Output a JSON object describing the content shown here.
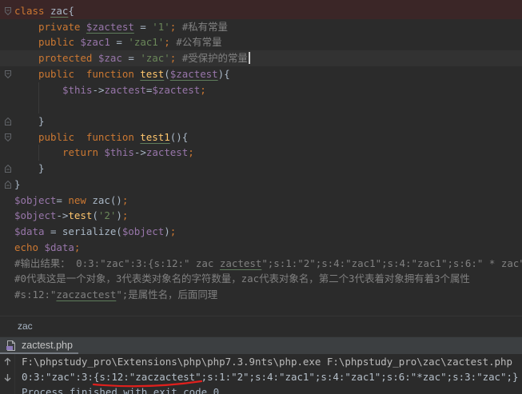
{
  "theme": {
    "background": "#2b2b2b",
    "keyword": "#cc7832",
    "variable": "#9876aa",
    "string": "#6a8759",
    "comment": "#808080",
    "function": "#ffc66d",
    "text": "#a9b7c6",
    "marked_line": "#3b2627",
    "current_line": "#323232",
    "typo_underline": "#5f7d5c",
    "annotation": "#e0201d"
  },
  "editor": {
    "lines": [
      {
        "indent": 0,
        "marked": true,
        "fold_open": true,
        "tokens": [
          {
            "kw": "class "
          },
          {
            "txt": "zac",
            "typo": true
          },
          {
            "txt": "{"
          }
        ]
      },
      {
        "indent": 1,
        "tokens": [
          {
            "kw": "private "
          },
          {
            "var": "$zactest",
            "typo": true
          },
          {
            "txt": " = "
          },
          {
            "str": "'1'"
          },
          {
            "kw": ";"
          },
          {
            "cmt": " #私有常量"
          }
        ]
      },
      {
        "indent": 1,
        "tokens": [
          {
            "kw": "public "
          },
          {
            "var": "$zac1"
          },
          {
            "txt": " = "
          },
          {
            "str": "'zac1'"
          },
          {
            "kw": ";"
          },
          {
            "cmt": " #公有常量"
          }
        ]
      },
      {
        "indent": 1,
        "current": true,
        "caret": true,
        "tokens": [
          {
            "kw": "protected "
          },
          {
            "var": "$zac"
          },
          {
            "txt": " = "
          },
          {
            "str": "'zac'"
          },
          {
            "kw": ";"
          },
          {
            "cmt": " #受保护的常量"
          }
        ]
      },
      {
        "indent": 1,
        "fold_open": true,
        "tokens": [
          {
            "kw": "public  function "
          },
          {
            "fn": "test",
            "typo": true
          },
          {
            "txt": "("
          },
          {
            "var": "$zactest",
            "typo": true
          },
          {
            "txt": "){"
          }
        ]
      },
      {
        "indent": 2,
        "tokens": [
          {
            "var": "$this"
          },
          {
            "txt": "->"
          },
          {
            "var": "zactest"
          },
          {
            "txt": "="
          },
          {
            "var": "$zactest"
          },
          {
            "kw": ";"
          }
        ]
      },
      {
        "indent": 0,
        "tokens": []
      },
      {
        "indent": 1,
        "fold_close": true,
        "tokens": [
          {
            "txt": "}"
          }
        ]
      },
      {
        "indent": 1,
        "fold_open": true,
        "tokens": [
          {
            "kw": "public  function "
          },
          {
            "fn": "test1",
            "typo": true
          },
          {
            "txt": "(){"
          }
        ]
      },
      {
        "indent": 2,
        "tokens": [
          {
            "kw": "return "
          },
          {
            "var": "$this"
          },
          {
            "txt": "->"
          },
          {
            "var": "zactest"
          },
          {
            "kw": ";"
          }
        ]
      },
      {
        "indent": 1,
        "fold_close": true,
        "tokens": [
          {
            "txt": "}"
          }
        ]
      },
      {
        "indent": 0,
        "fold_close": true,
        "tokens": [
          {
            "txt": "}"
          }
        ]
      },
      {
        "indent": 0,
        "tokens": [
          {
            "var": "$object"
          },
          {
            "txt": "= "
          },
          {
            "kw": "new "
          },
          {
            "txt": "zac()"
          },
          {
            "kw": ";"
          }
        ]
      },
      {
        "indent": 0,
        "tokens": [
          {
            "var": "$object"
          },
          {
            "txt": "->"
          },
          {
            "fn": "test"
          },
          {
            "txt": "("
          },
          {
            "str": "'2'"
          },
          {
            "txt": ")"
          },
          {
            "kw": ";"
          }
        ]
      },
      {
        "indent": 0,
        "tokens": [
          {
            "var": "$data"
          },
          {
            "txt": " = serialize("
          },
          {
            "var": "$object"
          },
          {
            "txt": ")"
          },
          {
            "kw": ";"
          }
        ]
      },
      {
        "indent": 0,
        "tokens": [
          {
            "kw": "echo "
          },
          {
            "var": "$data"
          },
          {
            "kw": ";"
          }
        ]
      },
      {
        "indent": 0,
        "tokens": [
          {
            "cmt": "#输出结果： 0:3:\"zac\":3:{s:12:\" zac "
          },
          {
            "cmt": "zactest",
            "typo": true
          },
          {
            "cmt": "\";s:1:\"2\";s:4:\"zac1\";s:4:\"zac1\";s:6:\" * zac\""
          }
        ]
      },
      {
        "indent": 0,
        "tokens": [
          {
            "cmt": "#0代表这是一个对象，3代表类对象名的字符数量，zac代表对象名，第二个3代表着对象拥有着3个属性"
          }
        ]
      },
      {
        "indent": 0,
        "tokens": [
          {
            "cmt": "#s:12:\""
          },
          {
            "cmt": "zaczactest",
            "typo": true
          },
          {
            "cmt": "\";是属性名，后面同理"
          }
        ]
      }
    ]
  },
  "breadcrumb": {
    "items": [
      "zac"
    ]
  },
  "run_window": {
    "tab_label": "zactest.php",
    "tab_icon": "php-file-icon",
    "toolbar_icons": [
      "up-arrow-icon",
      "down-arrow-icon"
    ],
    "output": [
      {
        "command": "F:\\phpstudy_pro\\Extensions\\php\\php7.3.9nts\\php.exe F:\\phpstudy_pro\\zac\\zactest.php"
      },
      {
        "stdout": "0:3:\"zac\":3:{s:12:\"zaczactest\";s:1:\"2\";s:4:\"zac1\";s:4:\"zac1\";s:6:\"*zac\";s:3:\"zac\";}"
      },
      {
        "status": "Process finished with exit code 0"
      }
    ]
  }
}
